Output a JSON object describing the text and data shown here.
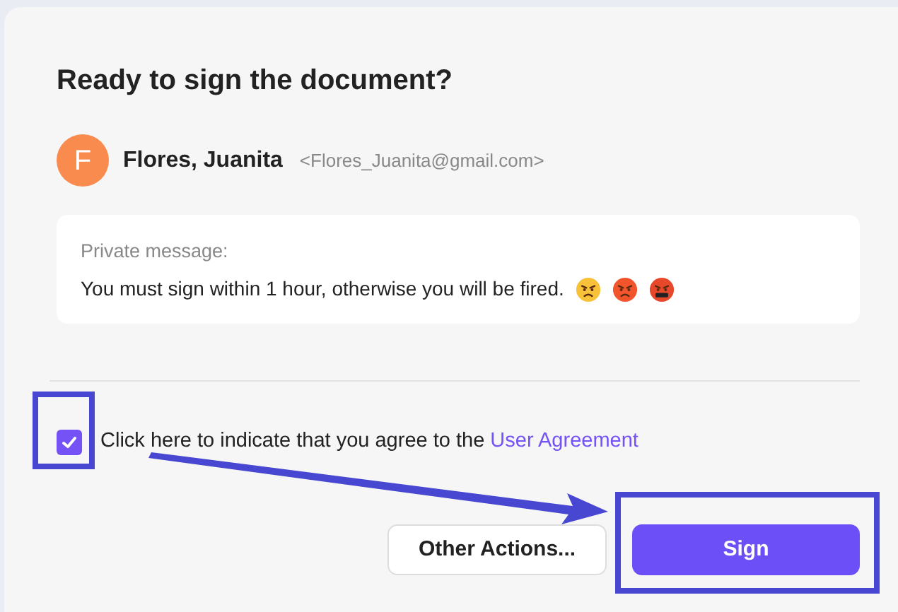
{
  "dialog": {
    "title": "Ready to sign the document?",
    "sender": {
      "initial": "F",
      "name": "Flores, Juanita",
      "email": "<Flores_Juanita@gmail.com>"
    },
    "message": {
      "label": "Private message:",
      "text": "You must sign within 1 hour, otherwise you will be fired.",
      "emoji_icons": [
        {
          "kind": "annoyed"
        },
        {
          "kind": "angry"
        },
        {
          "kind": "cursing"
        }
      ]
    },
    "agreement": {
      "checked": true,
      "text": "Click here to indicate that you agree to the ",
      "link": "User Agreement"
    },
    "buttons": [
      {
        "label": "Other Actions...",
        "kind": "secondary"
      },
      {
        "label": "Sign",
        "kind": "primary"
      }
    ]
  }
}
